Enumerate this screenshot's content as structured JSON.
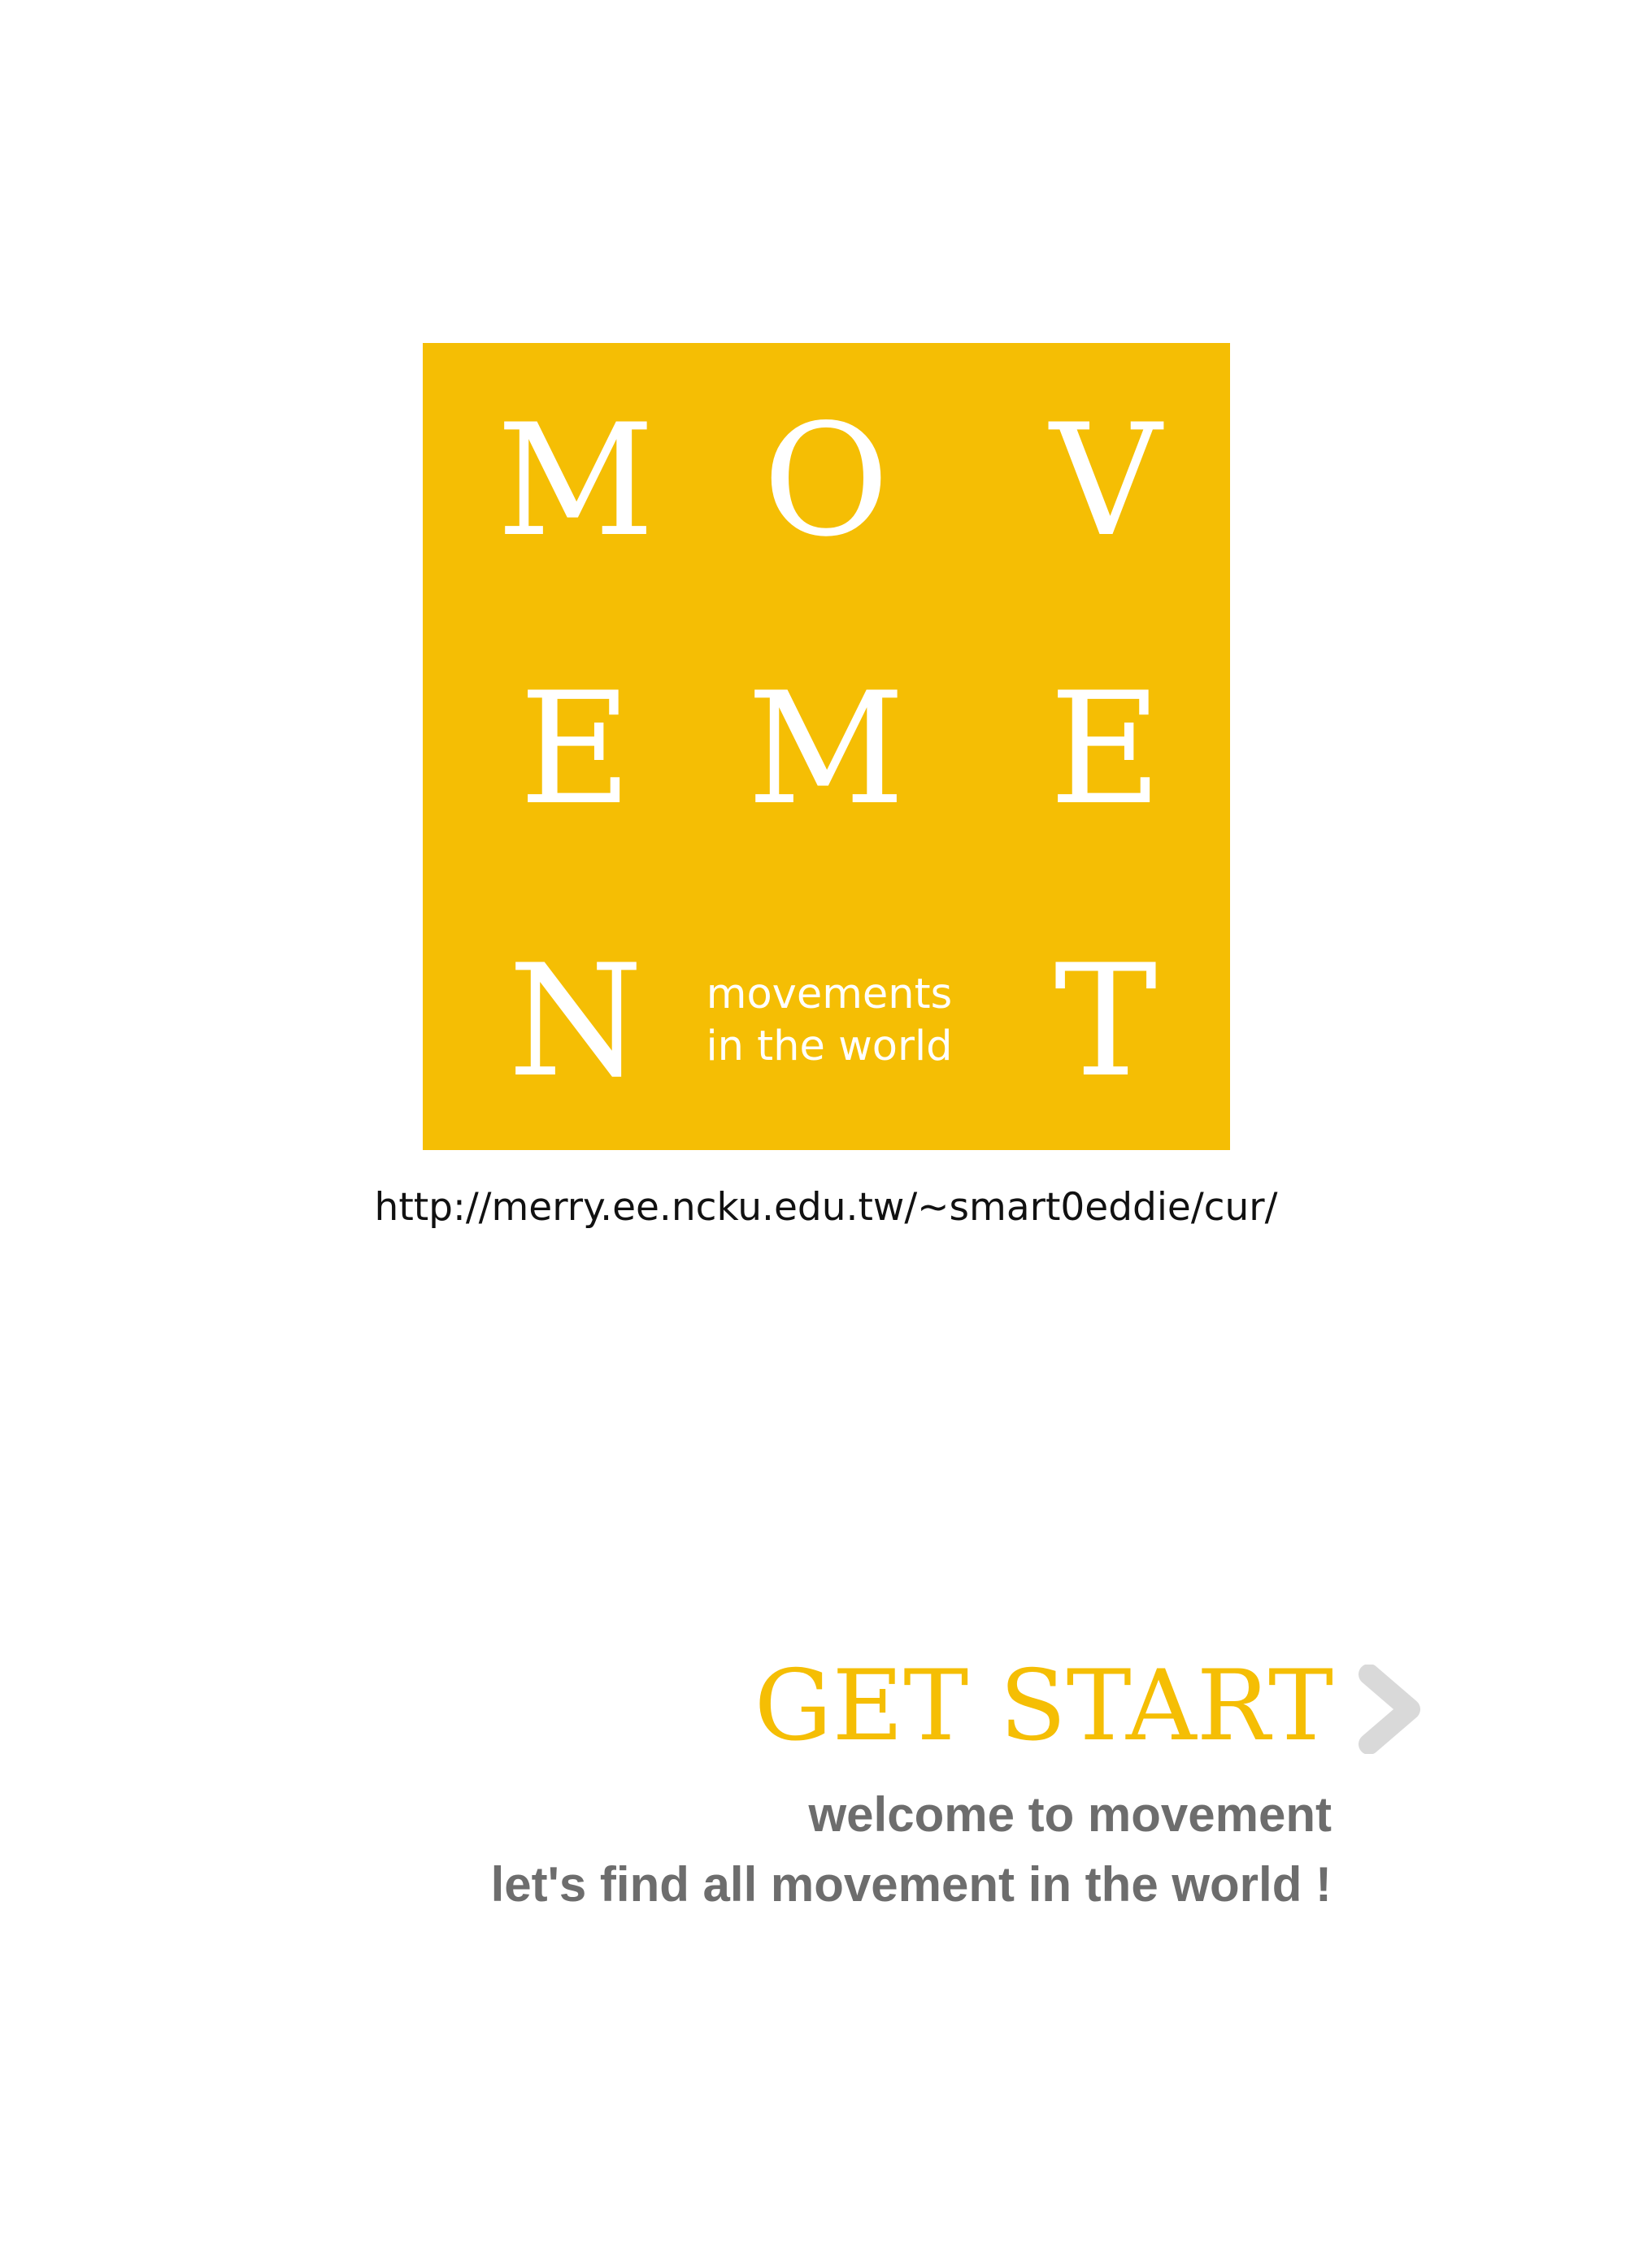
{
  "logo": {
    "letters": [
      "M",
      "O",
      "V",
      "E",
      "M",
      "E",
      "N",
      "T"
    ],
    "tagline_line1": "movements",
    "tagline_line2": "in the world",
    "color": "#f5be04"
  },
  "url": "http://merry.ee.ncku.edu.tw/~smart0eddie/cur/",
  "cta": {
    "label": "GET START",
    "icon": "chevron-right-icon",
    "color": "#f5be04",
    "icon_color": "#d9d9d9"
  },
  "welcome": {
    "line1": "welcome to movement",
    "line2": "let's find all movement in the world !",
    "color": "#6d6d6d"
  }
}
